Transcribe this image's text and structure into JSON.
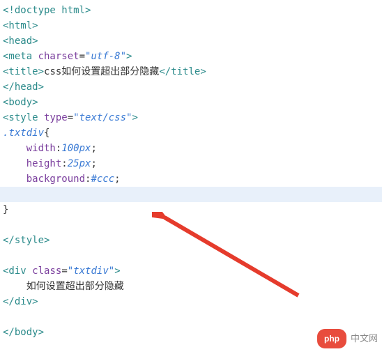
{
  "code": {
    "l1_doctype": "<!doctype html>",
    "l2_html_open": "<html>",
    "l3_head_open": "<head>",
    "l4_meta": "<meta ",
    "l4_charset": "charset",
    "l4_eq": "=",
    "l4_val": "\"utf-8\"",
    "l4_close": ">",
    "l5_title_open": "<title>",
    "l5_text": "css如何设置超出部分隐藏",
    "l5_title_close": "</title>",
    "l6_head_close": "</head>",
    "l7_body_open": "<body>",
    "l8_style_open": "<style ",
    "l8_type": "type",
    "l8_eq": "=",
    "l8_val": "\"text/css\"",
    "l8_close": ">",
    "l9_sel": ".txtdiv",
    "l9_brace": "{",
    "l10_prop": "width",
    "l10_colon": ":",
    "l10_val": "100px",
    "l10_semi": ";",
    "l11_prop": "height",
    "l11_colon": ":",
    "l11_val": "25px",
    "l11_semi": ";",
    "l12_prop": "background",
    "l12_colon": ":",
    "l12_val": "#ccc",
    "l12_semi": ";",
    "l14_brace": "}",
    "l16_style_close": "</style>",
    "l18_div_open": "<div ",
    "l18_class": "class",
    "l18_eq": "=",
    "l18_val": "\"txtdiv\"",
    "l18_close": ">",
    "l19_text": "如何设置超出部分隐藏",
    "l20_div_close": "</div>",
    "l22_body_close": "</body>"
  },
  "watermark": {
    "pill": "php",
    "text": "中文网"
  }
}
